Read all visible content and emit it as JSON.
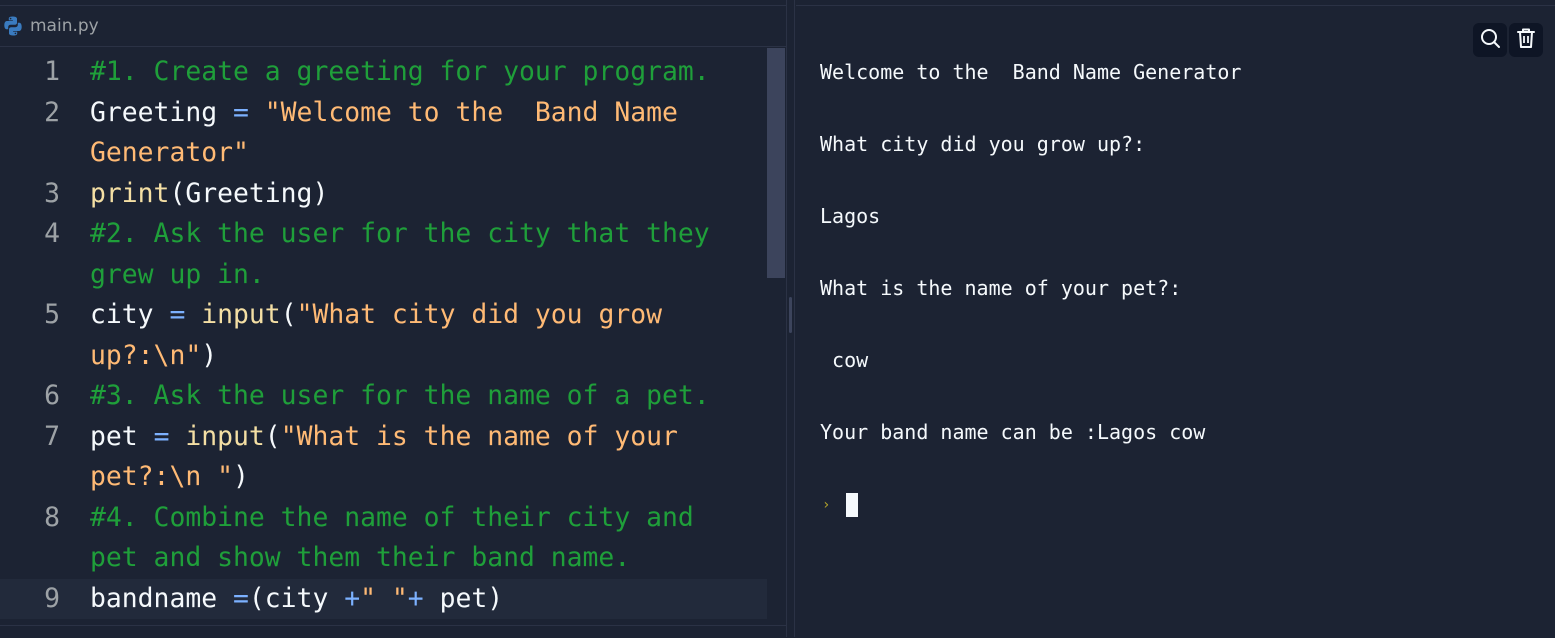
{
  "editor": {
    "tab_label": "main.py",
    "lines": [
      {
        "num": "1",
        "segments": [
          {
            "t": "#1. Create a greeting for your program.",
            "c": "c-comment"
          }
        ]
      },
      {
        "num": "2",
        "segments": [
          {
            "t": "Greeting ",
            "c": "c-ident"
          },
          {
            "t": "=",
            "c": "c-op"
          },
          {
            "t": " \"Welcome to the  Band Name Generator\"",
            "c": "c-str"
          }
        ]
      },
      {
        "num": "3",
        "segments": [
          {
            "t": "print",
            "c": "c-fn"
          },
          {
            "t": "(Greeting)",
            "c": "c-paren"
          }
        ]
      },
      {
        "num": "4",
        "segments": [
          {
            "t": "#2. Ask the user for the city that they grew up in.",
            "c": "c-comment"
          }
        ]
      },
      {
        "num": "5",
        "segments": [
          {
            "t": "city ",
            "c": "c-ident"
          },
          {
            "t": "=",
            "c": "c-op"
          },
          {
            "t": " ",
            "c": "c-ident"
          },
          {
            "t": "input",
            "c": "c-fn"
          },
          {
            "t": "(",
            "c": "c-paren"
          },
          {
            "t": "\"What city did you grow up?:\\n\"",
            "c": "c-str"
          },
          {
            "t": ")",
            "c": "c-paren"
          }
        ]
      },
      {
        "num": "6",
        "segments": [
          {
            "t": "#3. Ask the user for the name of a pet.",
            "c": "c-comment"
          }
        ]
      },
      {
        "num": "7",
        "segments": [
          {
            "t": "pet ",
            "c": "c-ident"
          },
          {
            "t": "=",
            "c": "c-op"
          },
          {
            "t": " ",
            "c": "c-ident"
          },
          {
            "t": "input",
            "c": "c-fn"
          },
          {
            "t": "(",
            "c": "c-paren"
          },
          {
            "t": "\"What is the name of your pet?:\\n \"",
            "c": "c-str"
          },
          {
            "t": ")",
            "c": "c-paren"
          }
        ]
      },
      {
        "num": "8",
        "segments": [
          {
            "t": "#4. Combine the name of their city and pet and show them their band name.",
            "c": "c-comment"
          }
        ]
      },
      {
        "num": "9",
        "active": true,
        "segments": [
          {
            "t": "bandname ",
            "c": "c-ident"
          },
          {
            "t": "=",
            "c": "c-op"
          },
          {
            "t": "(city ",
            "c": "c-paren"
          },
          {
            "t": "+",
            "c": "c-op"
          },
          {
            "t": "\" \"",
            "c": "c-str"
          },
          {
            "t": "+",
            "c": "c-op"
          },
          {
            "t": " pet)",
            "c": "c-paren"
          }
        ]
      }
    ]
  },
  "console": {
    "output_lines": [
      "Welcome to the  Band Name Generator",
      "What city did you grow up?:",
      "Lagos",
      "What is the name of your pet?:",
      " cow",
      "Your band name can be :Lagos cow"
    ],
    "prompt_symbol": "›",
    "search_icon": "search-icon",
    "clear_icon": "trash-icon"
  },
  "colors": {
    "background": "#1c2333",
    "comment": "#1f9f3a",
    "string": "#ffba75",
    "function": "#f4dfa4",
    "operator": "#7cb1ff",
    "text": "#f5f9fc"
  }
}
